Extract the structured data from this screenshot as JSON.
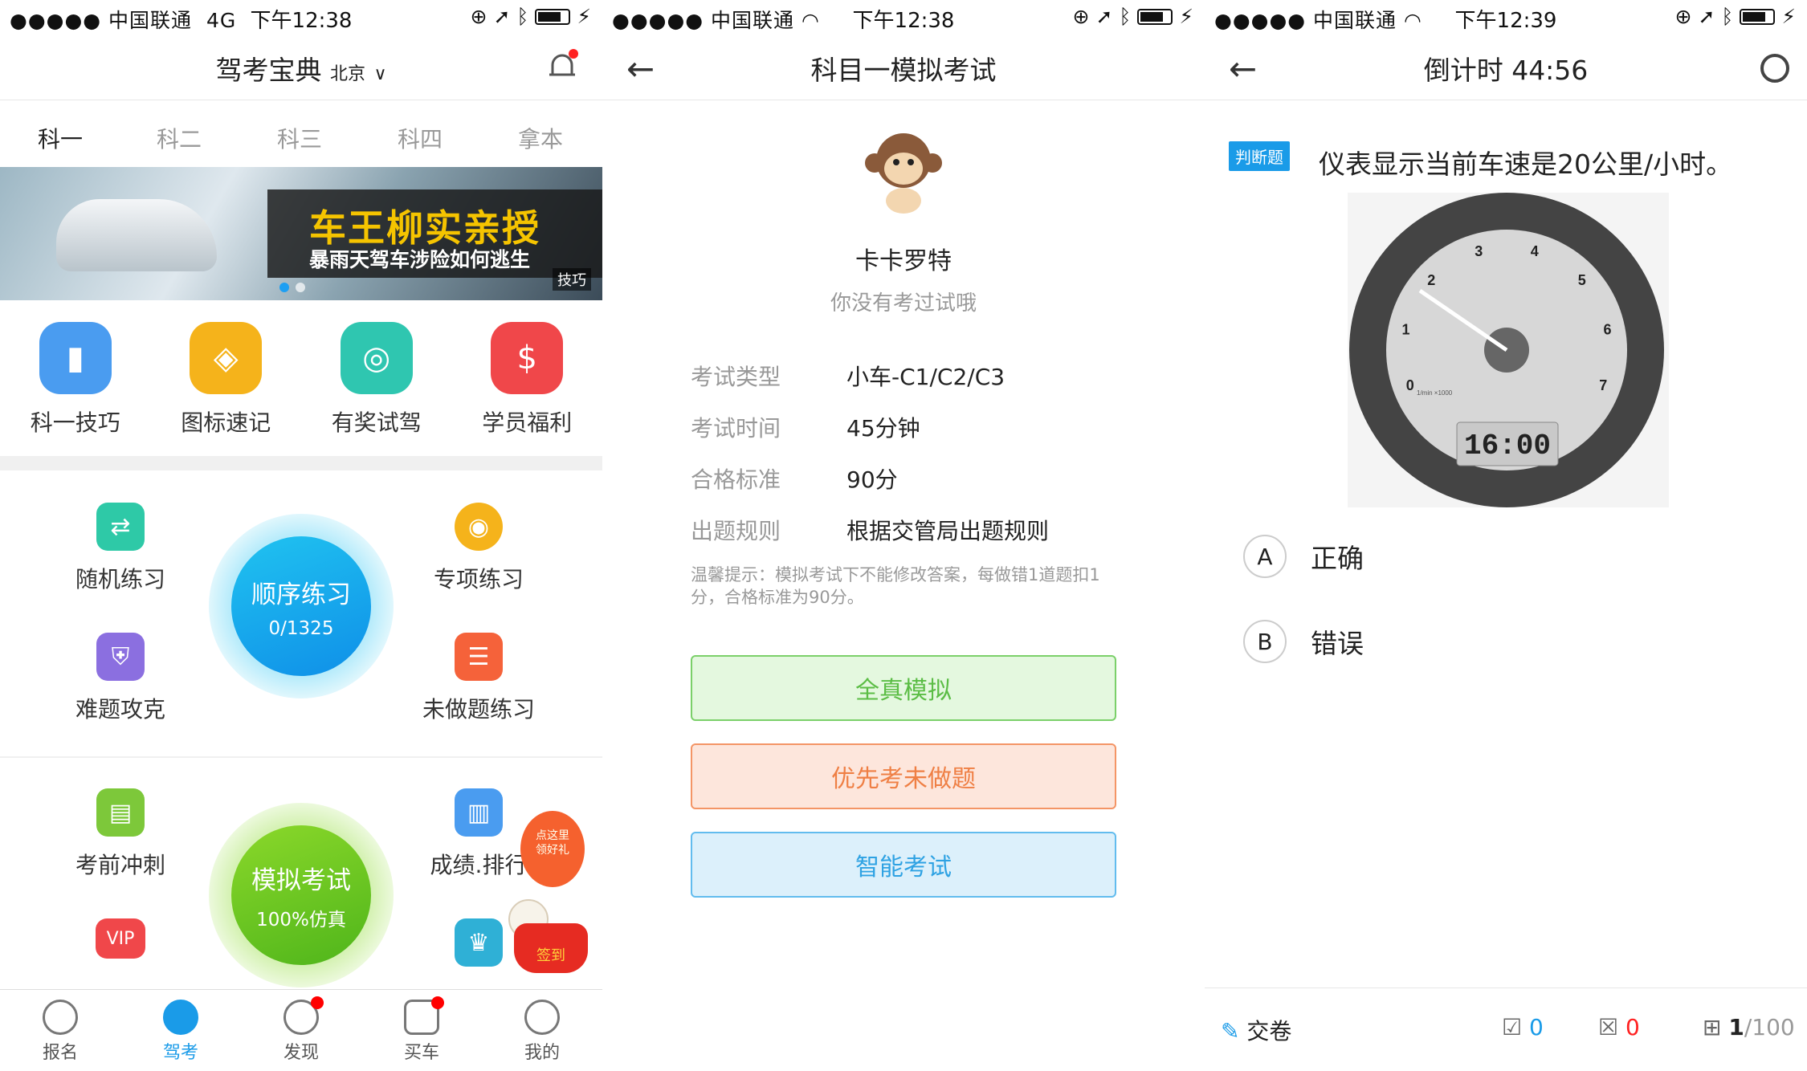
{
  "screen1": {
    "status": {
      "carrier": "●●●●● 中国联通",
      "network": "4G",
      "time": "下午12:38"
    },
    "header": {
      "title": "驾考宝典",
      "city": "北京"
    },
    "tabs": [
      "科一",
      "科二",
      "科三",
      "科四",
      "拿本"
    ],
    "banner": {
      "title": "车王柳实亲授",
      "subtitle": "暴雨天驾车涉险如何逃生",
      "badge": "技巧"
    },
    "quick": [
      {
        "label": "科一技巧",
        "icon": "book-icon",
        "color": "#4a9cf0"
      },
      {
        "label": "图标速记",
        "icon": "map-icon",
        "color": "#f5b31b"
      },
      {
        "label": "有奖试驾",
        "icon": "steering-wheel-icon",
        "color": "#2fc6b0"
      },
      {
        "label": "学员福利",
        "icon": "money-bag-icon",
        "color": "#f0474a"
      }
    ],
    "practice": {
      "random": "随机练习",
      "special": "专项练习",
      "hard": "难题攻克",
      "undone": "未做题练习",
      "order_title": "顺序练习",
      "order_progress": "0/1325"
    },
    "exam": {
      "sprint": "考前冲刺",
      "rank": "成绩.排行",
      "vip_badge": "VIP",
      "mock_title": "模拟考试",
      "mock_sub": "100%仿真",
      "promo_line1": "点这里",
      "promo_line2": "领好礼",
      "promo_sign": "签到"
    },
    "tabbar": [
      "报名",
      "驾考",
      "发现",
      "买车",
      "我的"
    ]
  },
  "screen2": {
    "status": {
      "carrier": "●●●●● 中国联通",
      "time": "下午12:38"
    },
    "title": "科目一模拟考试",
    "user_name": "卡卡罗特",
    "user_sub": "你没有考过试哦",
    "rows": [
      {
        "k": "考试类型",
        "v": "小车-C1/C2/C3"
      },
      {
        "k": "考试时间",
        "v": "45分钟"
      },
      {
        "k": "合格标准",
        "v": "90分"
      },
      {
        "k": "出题规则",
        "v": "根据交管局出题规则"
      }
    ],
    "tip": "温馨提示：模拟考试下不能修改答案，每做错1道题扣1分，合格标准为90分。",
    "buttons": [
      "全真模拟",
      "优先考未做题",
      "智能考试"
    ]
  },
  "screen3": {
    "status": {
      "carrier": "●●●●● 中国联通",
      "time": "下午12:39"
    },
    "title": "倒计时 44:56",
    "qtype": "判断题",
    "question": "仪表显示当前车速是20公里/小时。",
    "gauge": {
      "digital": "16:00",
      "ticks": [
        "0",
        "1",
        "2",
        "3",
        "4",
        "5",
        "6",
        "7"
      ],
      "unit": "1/min ×1000"
    },
    "options": [
      {
        "key": "A",
        "text": "正确"
      },
      {
        "key": "B",
        "text": "错误"
      }
    ],
    "footer": {
      "submit": "交卷",
      "right": "0",
      "wrong": "0",
      "progress_current": "1",
      "progress_total": "/100"
    }
  }
}
